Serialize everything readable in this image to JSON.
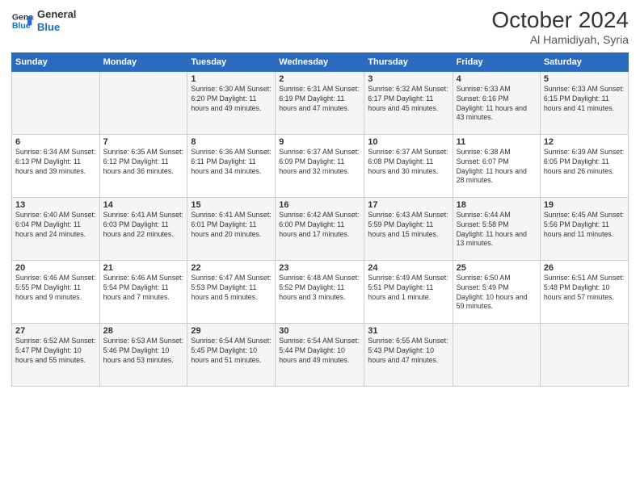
{
  "header": {
    "logo_line1": "General",
    "logo_line2": "Blue",
    "title": "October 2024",
    "subtitle": "Al Hamidiyah, Syria"
  },
  "days_of_week": [
    "Sunday",
    "Monday",
    "Tuesday",
    "Wednesday",
    "Thursday",
    "Friday",
    "Saturday"
  ],
  "weeks": [
    [
      {
        "day": "",
        "info": ""
      },
      {
        "day": "",
        "info": ""
      },
      {
        "day": "1",
        "info": "Sunrise: 6:30 AM\nSunset: 6:20 PM\nDaylight: 11 hours and 49 minutes."
      },
      {
        "day": "2",
        "info": "Sunrise: 6:31 AM\nSunset: 6:19 PM\nDaylight: 11 hours and 47 minutes."
      },
      {
        "day": "3",
        "info": "Sunrise: 6:32 AM\nSunset: 6:17 PM\nDaylight: 11 hours and 45 minutes."
      },
      {
        "day": "4",
        "info": "Sunrise: 6:33 AM\nSunset: 6:16 PM\nDaylight: 11 hours and 43 minutes."
      },
      {
        "day": "5",
        "info": "Sunrise: 6:33 AM\nSunset: 6:15 PM\nDaylight: 11 hours and 41 minutes."
      }
    ],
    [
      {
        "day": "6",
        "info": "Sunrise: 6:34 AM\nSunset: 6:13 PM\nDaylight: 11 hours and 39 minutes."
      },
      {
        "day": "7",
        "info": "Sunrise: 6:35 AM\nSunset: 6:12 PM\nDaylight: 11 hours and 36 minutes."
      },
      {
        "day": "8",
        "info": "Sunrise: 6:36 AM\nSunset: 6:11 PM\nDaylight: 11 hours and 34 minutes."
      },
      {
        "day": "9",
        "info": "Sunrise: 6:37 AM\nSunset: 6:09 PM\nDaylight: 11 hours and 32 minutes."
      },
      {
        "day": "10",
        "info": "Sunrise: 6:37 AM\nSunset: 6:08 PM\nDaylight: 11 hours and 30 minutes."
      },
      {
        "day": "11",
        "info": "Sunrise: 6:38 AM\nSunset: 6:07 PM\nDaylight: 11 hours and 28 minutes."
      },
      {
        "day": "12",
        "info": "Sunrise: 6:39 AM\nSunset: 6:05 PM\nDaylight: 11 hours and 26 minutes."
      }
    ],
    [
      {
        "day": "13",
        "info": "Sunrise: 6:40 AM\nSunset: 6:04 PM\nDaylight: 11 hours and 24 minutes."
      },
      {
        "day": "14",
        "info": "Sunrise: 6:41 AM\nSunset: 6:03 PM\nDaylight: 11 hours and 22 minutes."
      },
      {
        "day": "15",
        "info": "Sunrise: 6:41 AM\nSunset: 6:01 PM\nDaylight: 11 hours and 20 minutes."
      },
      {
        "day": "16",
        "info": "Sunrise: 6:42 AM\nSunset: 6:00 PM\nDaylight: 11 hours and 17 minutes."
      },
      {
        "day": "17",
        "info": "Sunrise: 6:43 AM\nSunset: 5:59 PM\nDaylight: 11 hours and 15 minutes."
      },
      {
        "day": "18",
        "info": "Sunrise: 6:44 AM\nSunset: 5:58 PM\nDaylight: 11 hours and 13 minutes."
      },
      {
        "day": "19",
        "info": "Sunrise: 6:45 AM\nSunset: 5:56 PM\nDaylight: 11 hours and 11 minutes."
      }
    ],
    [
      {
        "day": "20",
        "info": "Sunrise: 6:46 AM\nSunset: 5:55 PM\nDaylight: 11 hours and 9 minutes."
      },
      {
        "day": "21",
        "info": "Sunrise: 6:46 AM\nSunset: 5:54 PM\nDaylight: 11 hours and 7 minutes."
      },
      {
        "day": "22",
        "info": "Sunrise: 6:47 AM\nSunset: 5:53 PM\nDaylight: 11 hours and 5 minutes."
      },
      {
        "day": "23",
        "info": "Sunrise: 6:48 AM\nSunset: 5:52 PM\nDaylight: 11 hours and 3 minutes."
      },
      {
        "day": "24",
        "info": "Sunrise: 6:49 AM\nSunset: 5:51 PM\nDaylight: 11 hours and 1 minute."
      },
      {
        "day": "25",
        "info": "Sunrise: 6:50 AM\nSunset: 5:49 PM\nDaylight: 10 hours and 59 minutes."
      },
      {
        "day": "26",
        "info": "Sunrise: 6:51 AM\nSunset: 5:48 PM\nDaylight: 10 hours and 57 minutes."
      }
    ],
    [
      {
        "day": "27",
        "info": "Sunrise: 6:52 AM\nSunset: 5:47 PM\nDaylight: 10 hours and 55 minutes."
      },
      {
        "day": "28",
        "info": "Sunrise: 6:53 AM\nSunset: 5:46 PM\nDaylight: 10 hours and 53 minutes."
      },
      {
        "day": "29",
        "info": "Sunrise: 6:54 AM\nSunset: 5:45 PM\nDaylight: 10 hours and 51 minutes."
      },
      {
        "day": "30",
        "info": "Sunrise: 6:54 AM\nSunset: 5:44 PM\nDaylight: 10 hours and 49 minutes."
      },
      {
        "day": "31",
        "info": "Sunrise: 6:55 AM\nSunset: 5:43 PM\nDaylight: 10 hours and 47 minutes."
      },
      {
        "day": "",
        "info": ""
      },
      {
        "day": "",
        "info": ""
      }
    ]
  ]
}
